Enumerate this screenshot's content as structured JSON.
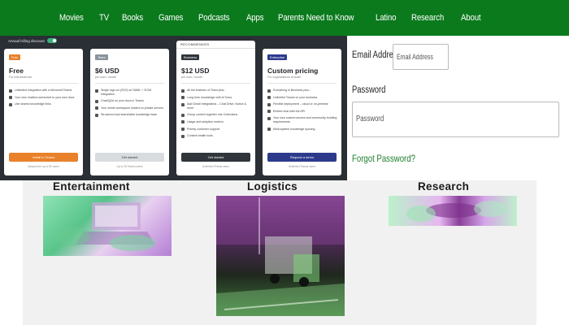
{
  "nav": {
    "items": [
      "Movies",
      "TV",
      "Books",
      "Games",
      "Podcasts",
      "Apps",
      "Parents Need to Know",
      "Latino",
      "Research",
      "About"
    ]
  },
  "pricing": {
    "toggle_label": "Annual billing discount",
    "recommended_label": "RECOMMENDED",
    "cards": [
      {
        "badge": "Free",
        "badge_color": "#e8812a",
        "price": "Free",
        "subtitle": "For individual use",
        "features": [
          "Unlimited integration with a Microsoft Teams",
          "Your own chatbot connected to your own docs",
          "Use shared knowledge links"
        ],
        "cta": "Install in Teams",
        "cta_color": "#e8812a",
        "fine": "Always free up to 50 users"
      },
      {
        "badge": "Team",
        "badge_color": "#8a939c",
        "price": "$6 USD",
        "subtitle": "per user / month",
        "features": [
          "Single sign-on (SSO) w/ SAML + SCIM integration",
          "Chat/Q&A on your docs in Teams",
          "Your whole workspace hosted on private servers",
          "Structured and searchable knowledge base"
        ],
        "cta": "Get started",
        "cta_color": "#d9dcdf",
        "fine": "Up to 25 Teams users"
      },
      {
        "badge": "Business",
        "badge_color": "#2f353b",
        "price": "$12 USD",
        "subtitle": "per user / month",
        "features": [
          "All the features of Team plus...",
          "Long form knowledge with AI Docs",
          "Add Gmail integrations – Chat Drive, Notion & more",
          "Group content together into Collections",
          "Usage and adoption metrics",
          "Priority customer support",
          "Content health tools"
        ],
        "cta": "Get started",
        "cta_color": "#2f353b",
        "fine": "Unlimited Teams users"
      },
      {
        "badge": "Enterprise",
        "badge_color": "#2d3a8c",
        "price": "Custom pricing",
        "subtitle": "For organizations at scale",
        "features": [
          "Everything in Business plus...",
          "Unlimited Teams w/ your business",
          "Flexible deployment – cloud or on-premise",
          "Embed chat with the API",
          "Your own custom access and community building requirements",
          "Multi-system knowledge syncing"
        ],
        "cta": "Request a demo",
        "cta_color": "#2d3a8c",
        "fine": "Unlimited Teams users"
      }
    ]
  },
  "login": {
    "email_label": "Email Address",
    "email_placeholder": "Email Address",
    "password_label": "Password",
    "password_placeholder": "Password",
    "forgot_label": "Forgot Password?"
  },
  "categories": [
    {
      "title": "Entertainment"
    },
    {
      "title": "Logistics"
    },
    {
      "title": "Research"
    }
  ],
  "colors": {
    "nav_bg": "#0b7a1d",
    "link": "#1d7e2b"
  }
}
